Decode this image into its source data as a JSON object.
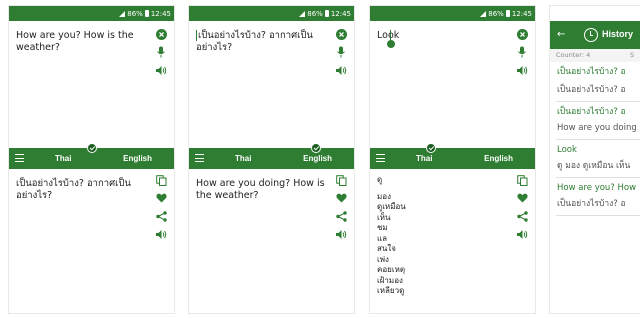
{
  "status": {
    "time": "12:45",
    "battery": "86%"
  },
  "colors": {
    "primary": "#2e7d32",
    "primary_dark": "#1b5e20",
    "text": "#222222",
    "muted": "#8a8a8a"
  },
  "icons": {
    "clear": "close-circle-icon",
    "mic": "microphone-icon",
    "speak": "speaker-icon",
    "copy": "copy-icon",
    "favorite": "heart-icon",
    "share": "share-icon",
    "menu": "hamburger-menu-icon",
    "back": "back-arrow-icon",
    "history": "clock-icon"
  },
  "screens": [
    {
      "source_text": "How are you? How is the weather?",
      "source_lang": "Thai",
      "target_lang": "English",
      "output_text": "เป็นอย่างไรบ้าง? อากาศเป็นอย่างไร?"
    },
    {
      "source_text": "เป็นอย่างไรบ้าง? อากาศเป็นอย่างไร?",
      "source_lang": "Thai",
      "target_lang": "English",
      "output_text": "How are you doing? How is the weather?"
    },
    {
      "source_text": "Look",
      "source_lang": "Thai",
      "target_lang": "English",
      "output_words": [
        "ดู",
        "มอง",
        "ดูเหมือน",
        "เห็น",
        "ชม",
        "แล",
        "สนใจ",
        "เพ่ง",
        "คอยเหตุ",
        "เฝ้ามอง",
        "เหลียวดู"
      ]
    }
  ],
  "history": {
    "title": "History",
    "counter": "Counter: 4",
    "counter_right": "S",
    "items": [
      {
        "source": "เป็นอย่างไรบ้าง? อ",
        "translation": "เป็นอย่างไรบ้าง? อ"
      },
      {
        "source": "เป็นอย่างไรบ้าง? อ",
        "translation": "How are you doing"
      },
      {
        "source": "Look",
        "translation": "ดู มอง ดูเหมือน เห็น"
      },
      {
        "source": "How are you? How",
        "translation": "เป็นอย่างไรบ้าง? อ"
      }
    ]
  }
}
